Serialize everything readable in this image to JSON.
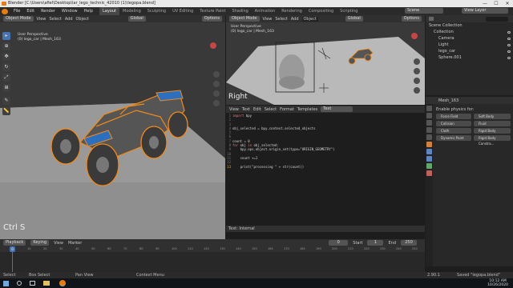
{
  "window": {
    "title": "Blender [C:\\Users\\afiel\\Desktop\\lar_lego_technic_42010 (1)\\legopa.blend]",
    "minimize": "—",
    "maximize": "☐",
    "close": "✕"
  },
  "menu": {
    "items": [
      "File",
      "Edit",
      "Render",
      "Window",
      "Help"
    ],
    "workspaces": [
      "Layout",
      "Modeling",
      "Sculpting",
      "UV Editing",
      "Texture Paint",
      "Shading",
      "Animation",
      "Rendering",
      "Compositing",
      "Scripting"
    ],
    "active_workspace": "Layout",
    "scene": "Scene",
    "view_layer": "View Layer"
  },
  "left_viewport": {
    "mode": "Object Mode",
    "menus": [
      "View",
      "Select",
      "Add",
      "Object"
    ],
    "orientation": "Global",
    "options": "Options",
    "info_title": "User Perspective",
    "info_sub": "(0) lego_car | Mesh_163",
    "overlay_text": "Ctrl S"
  },
  "right_viewport": {
    "mode": "Object Mode",
    "menus": [
      "View",
      "Select",
      "Add",
      "Object"
    ],
    "orientation": "Global",
    "options": "Options",
    "info_title": "User Perspective",
    "info_sub": "(0) lego_car | Mesh_163",
    "overlay_text": "Right"
  },
  "text_editor": {
    "menus": [
      "View",
      "Text",
      "Edit",
      "Select",
      "Format",
      "Templates"
    ],
    "file": "Text",
    "footer": "Text: Internal",
    "lines": [
      {
        "n": "1",
        "code": "import bpy"
      },
      {
        "n": "2",
        "code": ""
      },
      {
        "n": "3",
        "code": ""
      },
      {
        "n": "4",
        "code": "obj_selected = bpy.context.selected_objects"
      },
      {
        "n": "5",
        "code": ""
      },
      {
        "n": "6",
        "code": ""
      },
      {
        "n": "7",
        "code": "count = 0"
      },
      {
        "n": "8",
        "code": "for obj in obj_selected:"
      },
      {
        "n": "9",
        "code": "    bpy.ops.object.origin_set(type=\"ORIGIN_GEOMETRY\")"
      },
      {
        "n": "10",
        "code": ""
      },
      {
        "n": "11",
        "code": "    count +=1"
      },
      {
        "n": "12",
        "code": ""
      },
      {
        "n": "13",
        "code": "    print(\"processing \" + str(count))"
      }
    ],
    "current_line": "13"
  },
  "outliner": {
    "title": "Scene Collection",
    "items": [
      {
        "label": "Collection",
        "indent": 1
      },
      {
        "label": "Camera",
        "indent": 2
      },
      {
        "label": "Light",
        "indent": 2
      },
      {
        "label": "lego_car",
        "indent": 2
      },
      {
        "label": "Sphere.001",
        "indent": 2
      }
    ]
  },
  "properties": {
    "object": "Mesh_163",
    "section": "Enable physics for:",
    "buttons": [
      [
        "Force Field",
        "Soft Body"
      ],
      [
        "Collision",
        "Fluid"
      ],
      [
        "Cloth",
        "Rigid Body"
      ],
      [
        "Dynamic Paint",
        "Rigid Body Constra..."
      ]
    ]
  },
  "timeline": {
    "menus": [
      "Playback",
      "Keying",
      "View",
      "Marker"
    ],
    "current_frame": "0",
    "start_label": "Start",
    "start": "1",
    "end_label": "End",
    "end": "250",
    "ticks": [
      "0",
      "10",
      "20",
      "30",
      "40",
      "50",
      "60",
      "70",
      "80",
      "90",
      "100",
      "110",
      "120",
      "130",
      "140",
      "150",
      "160",
      "170",
      "180",
      "190",
      "200",
      "210",
      "220",
      "230",
      "240",
      "250"
    ]
  },
  "status": {
    "select": "Select",
    "box_select": "Box Select",
    "pan_view": "Pan View",
    "context_menu": "Context Menu",
    "version": "2.90.1",
    "saved": "Saved \"legopa.blend\""
  },
  "taskbar": {
    "time": "10:12 AM",
    "date": "10/26/2020"
  },
  "colors": {
    "accent": "#4772b3",
    "selection": "#f28a1a",
    "brand": "#e87d0d"
  }
}
